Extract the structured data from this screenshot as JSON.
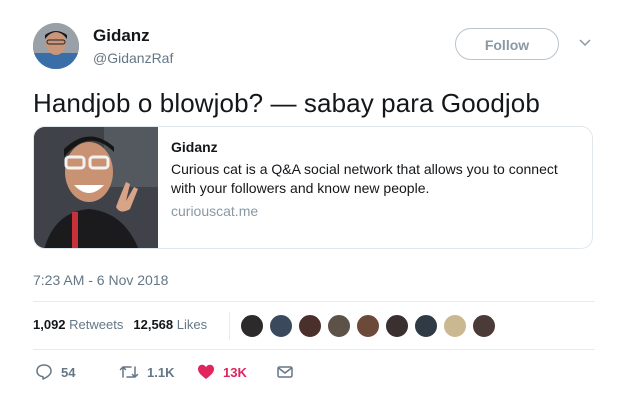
{
  "author": {
    "display_name": "Gidanz",
    "handle": "@GidanzRaf"
  },
  "follow_button": {
    "label": "Follow"
  },
  "tweet": {
    "text": "Handjob o blowjob? — sabay para Goodjob",
    "timestamp": "7:23 AM - 6 Nov 2018"
  },
  "card": {
    "title": "Gidanz",
    "description": "Curious cat is a Q&A social network that allows you to connect with your followers and know new people.",
    "domain": "curiouscat.me"
  },
  "stats": {
    "retweets_count": "1,092",
    "retweets_label": "Retweets",
    "likes_count": "12,568",
    "likes_label": "Likes"
  },
  "liker_avatars": [
    "#2d2a2b",
    "#3a4a5c",
    "#4a2f2a",
    "#5c5248",
    "#6b4a3a",
    "#3b3030",
    "#2f3a44",
    "#c9b890",
    "#4b3b38"
  ],
  "actions": {
    "replies": "54",
    "retweets": "1.1K",
    "likes": "13K"
  },
  "colors": {
    "like_red": "#e0245e",
    "muted_gray": "#657786",
    "border": "#e1e8ed"
  }
}
